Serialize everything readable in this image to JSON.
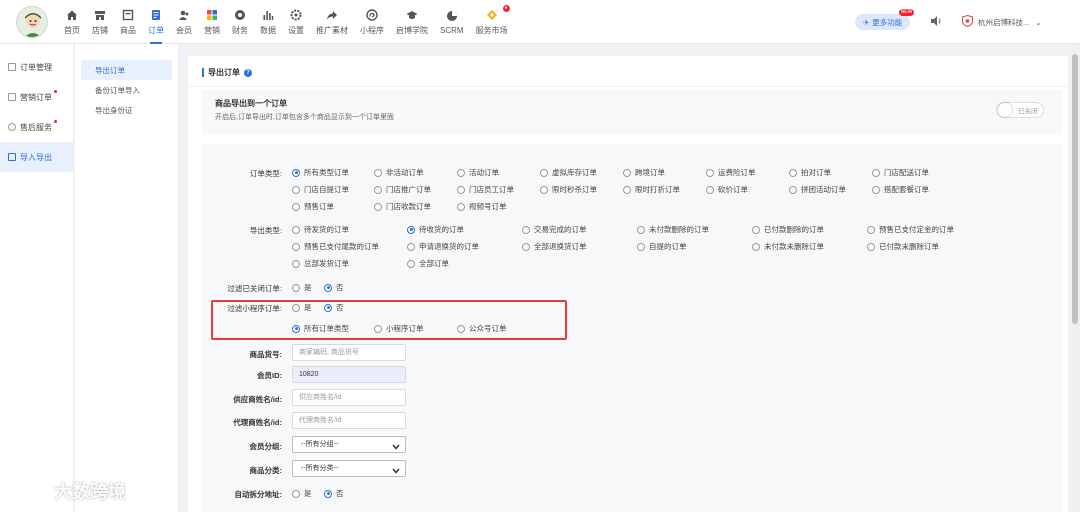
{
  "nav": {
    "items": [
      {
        "label": "首页",
        "icon": "home-icon"
      },
      {
        "label": "店铺",
        "icon": "store-icon"
      },
      {
        "label": "商品",
        "icon": "goods-icon"
      },
      {
        "label": "订单",
        "icon": "order-icon",
        "active": true
      },
      {
        "label": "会员",
        "icon": "member-icon"
      },
      {
        "label": "营销",
        "icon": "marketing-icon"
      },
      {
        "label": "财务",
        "icon": "finance-icon"
      },
      {
        "label": "数据",
        "icon": "data-icon"
      },
      {
        "label": "设置",
        "icon": "settings-icon"
      },
      {
        "label": "推广素材",
        "icon": "share-icon"
      },
      {
        "label": "小程序",
        "icon": "miniprogram-icon"
      },
      {
        "label": "启博学院",
        "icon": "academy-icon"
      },
      {
        "label": "SCRM",
        "icon": "scrm-icon"
      },
      {
        "label": "服务市场",
        "icon": "market-icon"
      }
    ],
    "more_label": "更多功能",
    "more_badge": "NEW",
    "shop_name": "杭州启博科技..."
  },
  "sidebar": {
    "items": [
      {
        "label": "订单管理"
      },
      {
        "label": "营销订单"
      },
      {
        "label": "售后服务"
      },
      {
        "label": "导入导出"
      }
    ]
  },
  "subnav": {
    "items": [
      {
        "label": "导出订单"
      },
      {
        "label": "备份订单导入"
      },
      {
        "label": "导出身份证"
      }
    ]
  },
  "main": {
    "title": "导出订单",
    "merge": {
      "title": "商品导出到一个订单",
      "desc": "开启后,订单导出时,订单包含多个商品显示到一个订单里面",
      "toggle_label": "已关闭"
    },
    "order_type": {
      "label": "订单类型:",
      "options": [
        "所有类型订单",
        "非活动订单",
        "活动订单",
        "虚拟库存订单",
        "跨境订单",
        "运费险订单",
        "拍对订单",
        "门店配送订单",
        "门店自提订单",
        "门店推广订单",
        "门店员工订单",
        "限时秒杀订单",
        "限时打折订单",
        "砍价订单",
        "拼团活动订单",
        "搭配套餐订单",
        "预售订单",
        "门店收款订单",
        "视频号订单"
      ]
    },
    "export_type": {
      "label": "导出类型:",
      "options": [
        "待发货的订单",
        "待收货的订单",
        "交易完成的订单",
        "未付款删除的订单",
        "已付款删除的订单",
        "预售已支付定金的订单",
        "预售已支付尾款的订单",
        "申请退换货的订单",
        "全部退换货订单",
        "自提的订单",
        "未付款未删除订单",
        "已付款未删除订单",
        "总部发货订单",
        "全部订单"
      ]
    },
    "filter_closed": {
      "label": "过滤已关闭订单:",
      "yes": "是",
      "no": "否"
    },
    "filter_mini": {
      "label": "过滤小程序订单:",
      "yes": "是",
      "no": "否",
      "options": [
        "所有订单类型",
        "小程序订单",
        "公众号订单"
      ]
    },
    "goods_no": {
      "label": "商品货号:",
      "placeholder": "商家编码, 商品货号"
    },
    "member_id": {
      "label": "会员ID:",
      "value": "10820"
    },
    "supplier": {
      "label": "供应商姓名/id:",
      "placeholder": "供应商姓名/id"
    },
    "agent": {
      "label": "代理商姓名/id:",
      "placeholder": "代理商姓名/id"
    },
    "member_group": {
      "label": "会员分组:",
      "value": "--所有分组--"
    },
    "goods_category": {
      "label": "商品分类:",
      "value": "--所有分类--"
    },
    "auto_split": {
      "label": "自动拆分地址:",
      "yes": "是",
      "no": "否"
    }
  },
  "watermark": "大数跨境",
  "colors": {
    "accent": "#2f6fd6",
    "highlight": "#e83b3b"
  }
}
